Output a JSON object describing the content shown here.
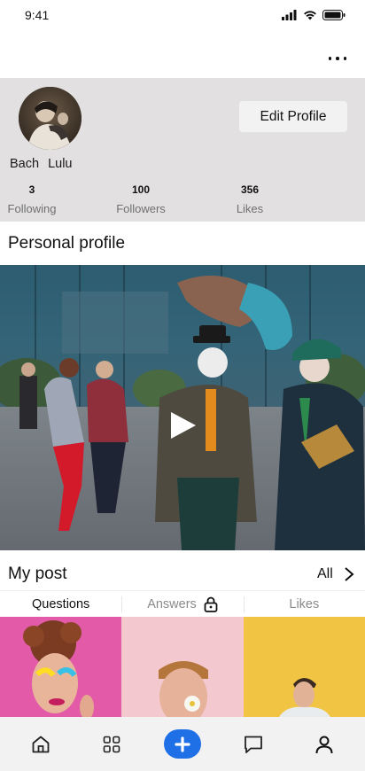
{
  "status_bar": {
    "time": "9:41"
  },
  "profile": {
    "name": "Bach  Lulu",
    "edit_button_label": "Edit Profile",
    "stats": [
      {
        "value": "3",
        "label": "Following"
      },
      {
        "value": "100",
        "label": "Followers"
      },
      {
        "value": "356",
        "label": "Likes"
      }
    ]
  },
  "personal_section": {
    "title": "Personal profile"
  },
  "posts": {
    "title": "My post",
    "all_label": "All",
    "tabs": [
      {
        "label": "Questions",
        "active": true
      },
      {
        "label": "Answers",
        "locked": true,
        "icon": "lock-icon"
      },
      {
        "label": "Likes",
        "active": false
      }
    ]
  },
  "bottom_nav": {
    "items": [
      {
        "icon": "home-icon"
      },
      {
        "icon": "grid-icon"
      },
      {
        "icon": "plus-icon"
      },
      {
        "icon": "chat-icon"
      },
      {
        "icon": "profile-icon"
      }
    ]
  },
  "colors": {
    "header_bg": "#e2e0e1",
    "accent": "#1f6fe6",
    "nav_bg": "#f2f2f2"
  }
}
